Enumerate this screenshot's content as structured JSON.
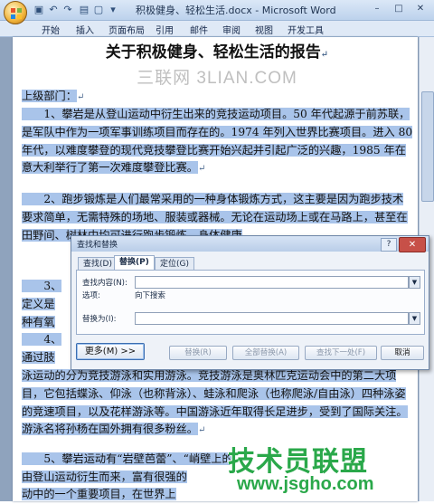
{
  "window": {
    "title": "积极健身、轻松生活.docx - Microsoft Word",
    "minimize": "–",
    "maximize": "□",
    "close": "✕"
  },
  "ribbon": {
    "tabs": [
      "开始",
      "插入",
      "页面布局",
      "引用",
      "邮件",
      "审阅",
      "视图",
      "开发工具"
    ]
  },
  "document": {
    "title": "关于积极健身、轻松生活的报告",
    "watermark": "三联网 3LIAN.COM",
    "greeting": "上级部门：",
    "paragraphs": [
      "　　1、攀岩是从登山运动中衍生出来的竞技运动项目。50 年代起源于前苏联，是军队中作为一项军事训练项目而存在的。1974 年列入世界比赛项目。进入 80 年代，以难度攀登的现代竞技攀登比赛开始兴起并引起广泛的兴趣，1985 年在意大利举行了第一次难度攀登比赛。",
      "　　2、跑步锻炼是人们最常采用的一种身体锻炼方式，这主要是因为跑步技术要求简单，无需特殊的场地、服装或器械。无论在运动场上或在马路上，甚至在田野间、树林中均可进行跑步锻炼，身体健康"
    ],
    "hidden_fragments": {
      "p3": "3、",
      "p3a": "定义是",
      "p3b": "种有氧",
      "p4": "4、",
      "p4a": "通过肢",
      "p4b": "泳运动的分为竞技游泳和实用游泳。竞技游泳是奥林匹克运动会中的第二大项目，它包括蝶泳、仰泳（也称背泳）、蛙泳和爬泳（也称爬泳/自由泳）四种泳姿的竞速项目，以及花样游泳等。中国游泳近年取得长足进步，受到了国际关注。游泳名将孙杨在国外拥有很多粉丝。",
      "p5": "　　5、攀岩运动有“岩壁芭蕾”、“峭壁上的",
      "p5a": "由登山运动衍生而来，富有很强的",
      "p5b": "动中的一个重要项目，在世界上"
    }
  },
  "dialog": {
    "title": "查找和替换",
    "help": "?",
    "close": "✕",
    "tabs": [
      "查找(D)",
      "替换(P)",
      "定位(G)"
    ],
    "find_label": "查找内容(N):",
    "find_value": "",
    "options_label": "选项:",
    "options_value": "向下搜索",
    "replace_label": "替换为(I):",
    "replace_value": "",
    "buttons": {
      "more": "更多(M) >>",
      "replace": "替换(R)",
      "replace_all": "全部替换(A)",
      "find_next": "查找下一处(F)",
      "cancel": "取消"
    }
  },
  "overlay": {
    "logo": "技术员联盟",
    "url": "www.jsgho.com"
  },
  "colors": {
    "selection": "#a9c4ea",
    "logo": "#2aa84a"
  }
}
